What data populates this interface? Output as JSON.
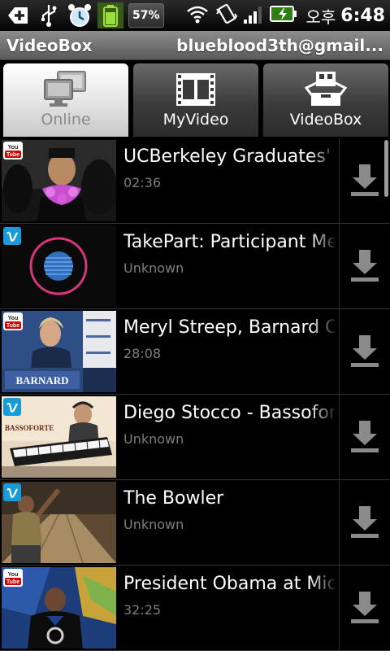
{
  "status_bar": {
    "battery_percent": "57%",
    "am_pm": "오후",
    "time": "6:48",
    "icons": [
      "add-icon",
      "usb-icon",
      "alarm-icon",
      "battery-app-icon",
      "wifi-icon",
      "vibrate-icon",
      "signal-icon",
      "battery-charging-icon"
    ]
  },
  "title_bar": {
    "app_name": "VideoBox",
    "account": "blueblood3th@gmail..."
  },
  "tabs": [
    {
      "label": "Online",
      "icon": "monitors-icon",
      "active": true
    },
    {
      "label": "MyVideo",
      "icon": "film-icon",
      "active": false
    },
    {
      "label": "VideoBox",
      "icon": "videobox-icon",
      "active": false
    }
  ],
  "videos": [
    {
      "title": "UCBerkeley Graduates' Tea",
      "duration": "02:36",
      "source": "youtube"
    },
    {
      "title": "TakePart: Participant Media",
      "duration": "Unknown",
      "source": "vimeo"
    },
    {
      "title": "Meryl Streep, Barnard Commencement",
      "duration": "28:08",
      "source": "youtube"
    },
    {
      "title": "Diego Stocco - Bassoforte",
      "duration": "Unknown",
      "source": "vimeo"
    },
    {
      "title": "The Bowler",
      "duration": "Unknown",
      "source": "vimeo"
    },
    {
      "title": "President Obama at Michigan",
      "duration": "32:25",
      "source": "youtube"
    }
  ],
  "thumb_texts": {
    "barnard": "BARNARD",
    "bassoforte": "BASSOFORTE",
    "youtube_top": "You",
    "youtube_bottom": "Tube"
  },
  "colors": {
    "background": "#000000",
    "title_bar": "#7a7a7a",
    "active_tab": "#e8e8e8",
    "subtitle": "#7d7d7d",
    "youtube_red": "#cc0000",
    "vimeo_blue": "#1a9bd7"
  }
}
